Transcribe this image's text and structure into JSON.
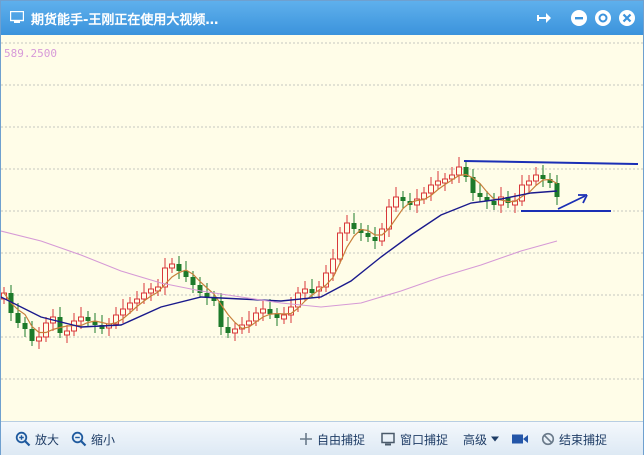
{
  "window": {
    "title": "期货能手-王刚正在使用大视频…"
  },
  "chart": {
    "top_price_label": "589.2500"
  },
  "statusbar": {
    "zoom_in_label": "放大",
    "zoom_out_label": "缩小",
    "free_capture_label": "自由捕捉",
    "window_capture_label": "窗口捕捉",
    "advanced_label": "高级",
    "end_capture_label": "结束捕捉"
  },
  "colors": {
    "titlebar": "#3b93dc",
    "up_candle": "#d8383a",
    "down_candle": "#1d7a2a",
    "ma_short": "#c8803c",
    "ma_long": "#1a1a8c",
    "ma_extra": "#d69ad6",
    "annotation": "#1a2fb5"
  },
  "icons": [
    "app-window-icon",
    "pin-icon",
    "minimize-icon",
    "restore-icon",
    "close-icon",
    "zoom-in-icon",
    "zoom-out-icon",
    "crosshair-icon",
    "window-capture-icon",
    "dropdown-arrow-icon",
    "camera-icon",
    "stop-icon"
  ]
}
